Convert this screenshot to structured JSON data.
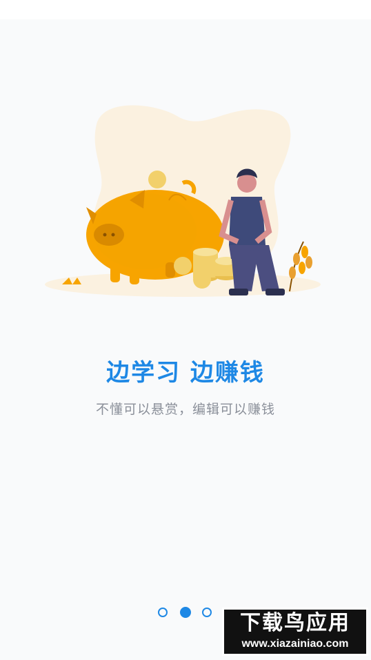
{
  "onboarding": {
    "title": "边学习 边赚钱",
    "subtitle": "不懂可以悬赏，编辑可以赚钱"
  },
  "pager": {
    "count": 3,
    "active_index": 1
  },
  "watermark": {
    "text": "下载鸟应用",
    "url": "www.xiazainiao.com"
  },
  "colors": {
    "accent": "#1e88e5",
    "pig": "#f7a400",
    "coin": "#f2d06b",
    "blob": "#fbf1e0",
    "person_shirt": "#3e4a7a"
  },
  "icons": {
    "illustration": "piggy-bank-illustration"
  }
}
